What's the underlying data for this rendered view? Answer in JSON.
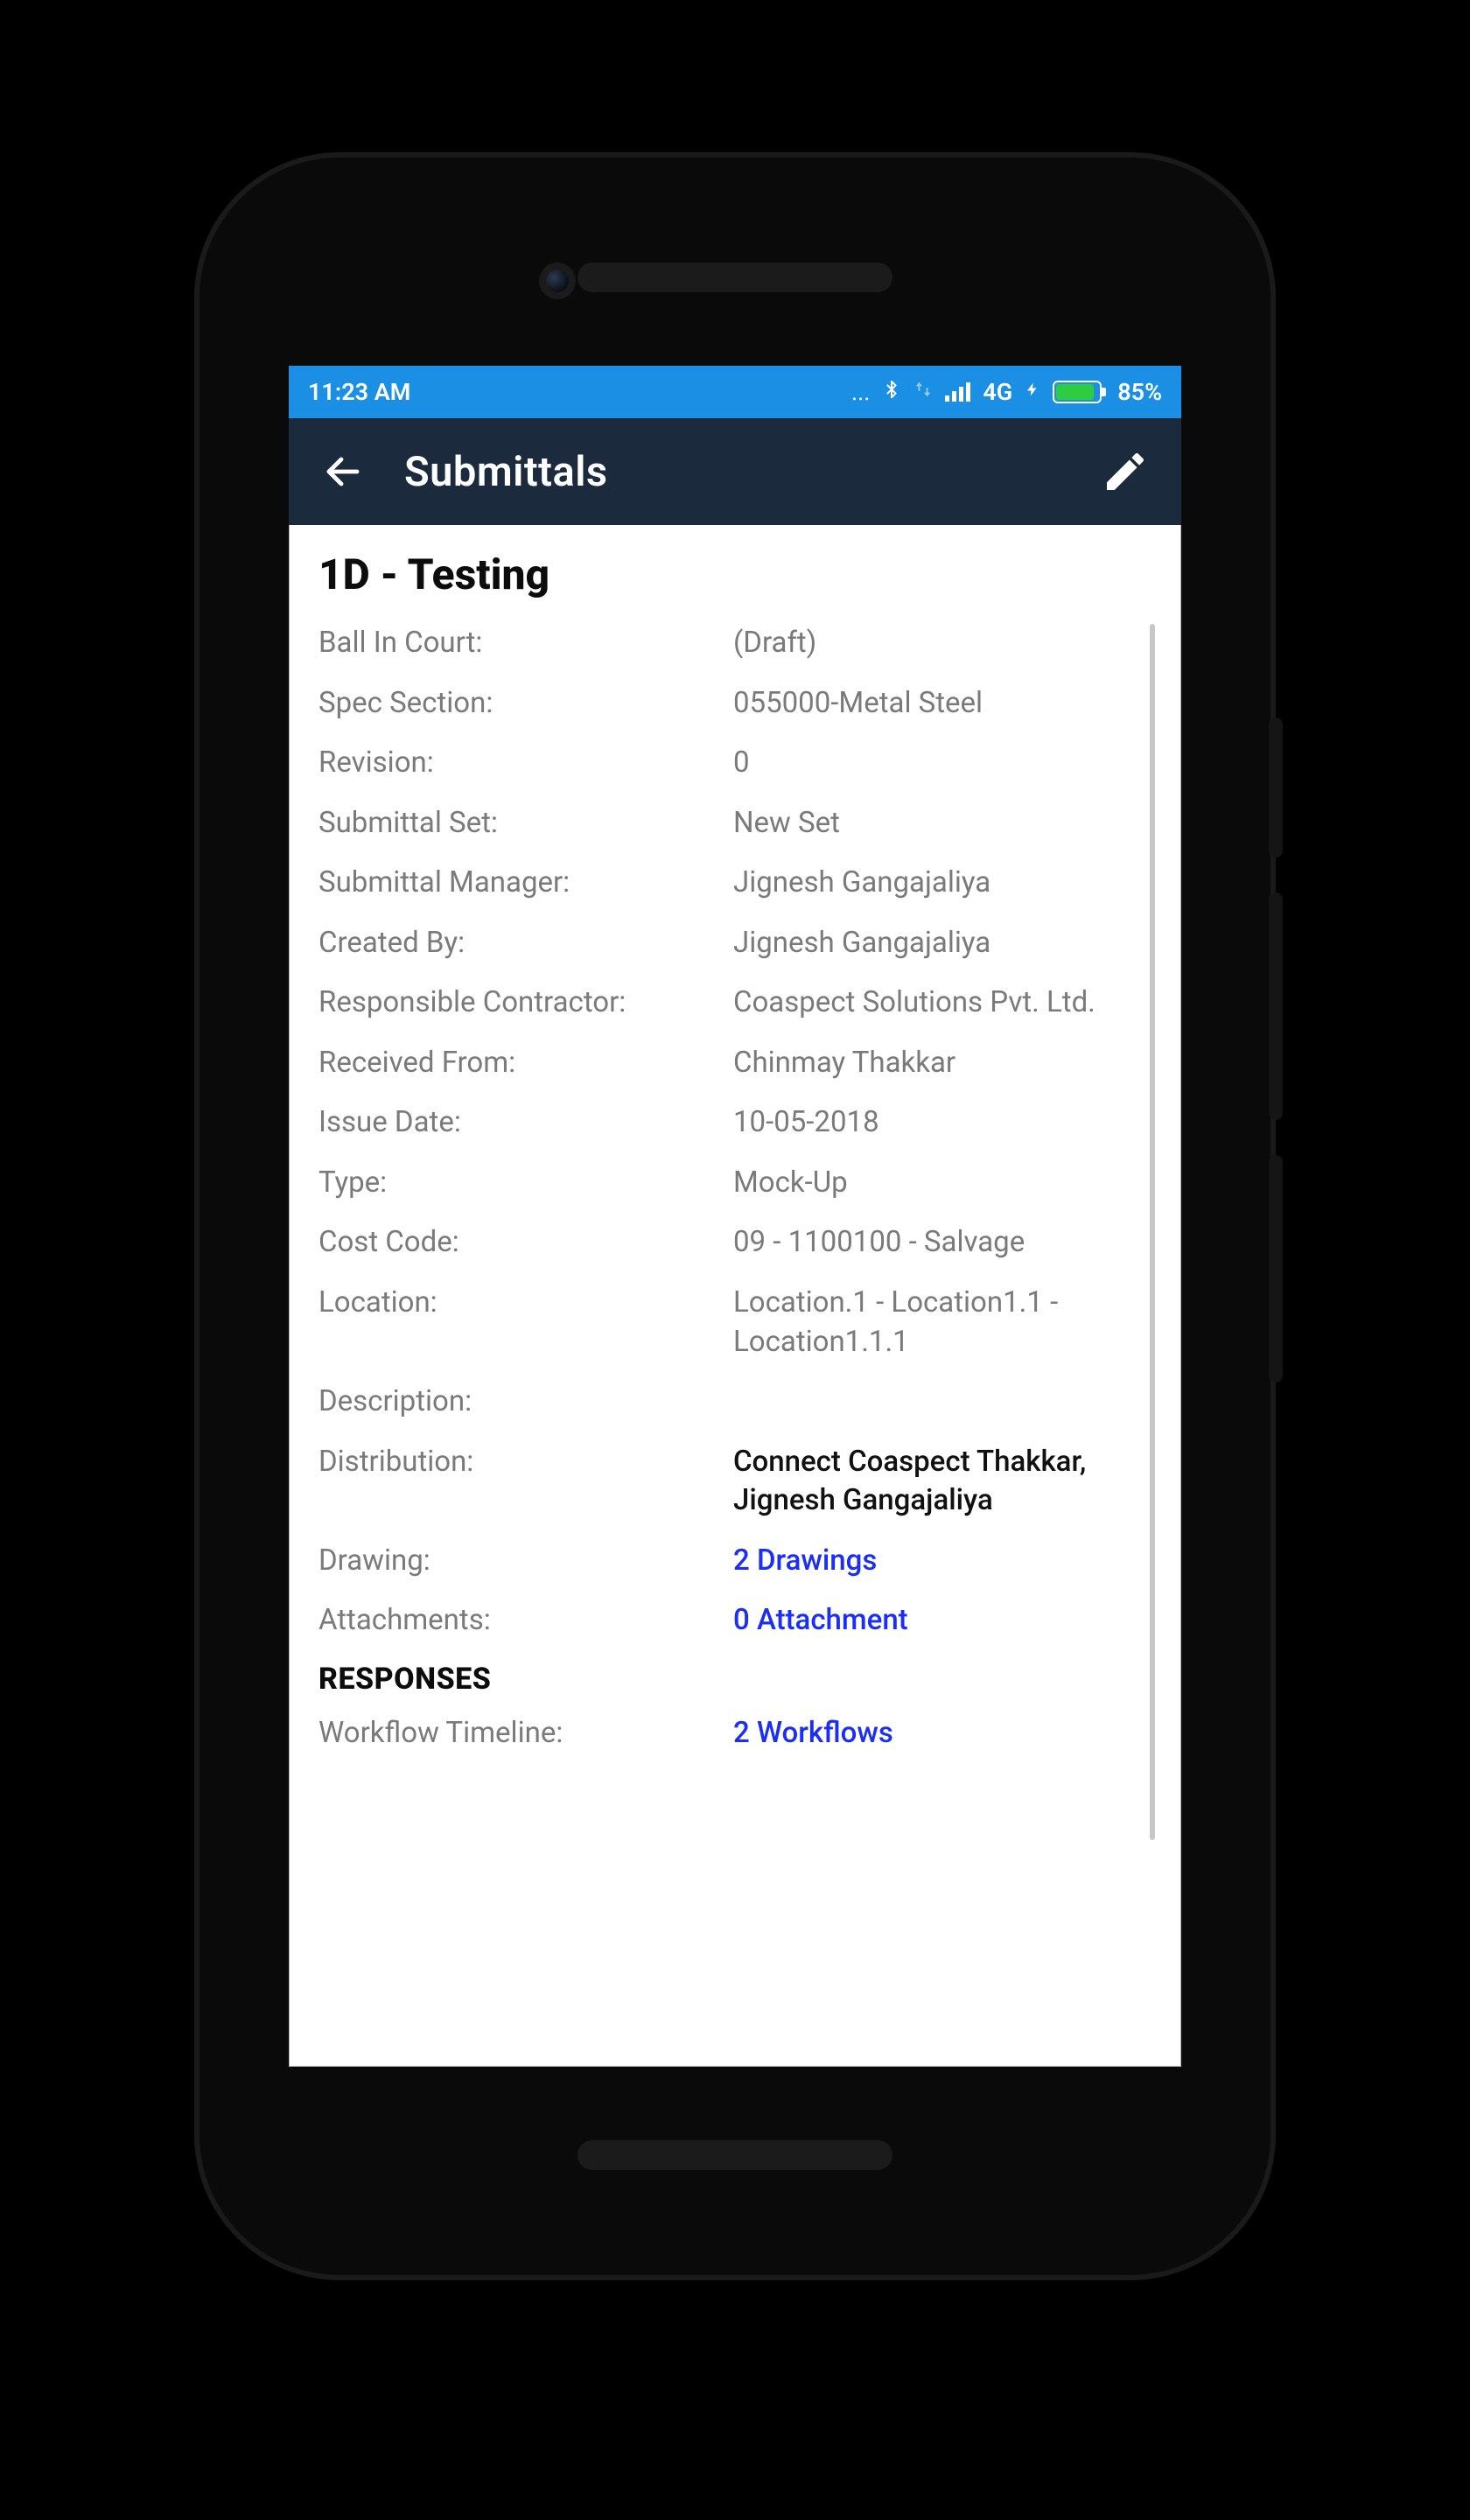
{
  "status": {
    "time": "11:23 AM",
    "dots": "...",
    "network": "4G",
    "charging": "⚡",
    "battery": "85%"
  },
  "appbar": {
    "title": "Submittals"
  },
  "page": {
    "title": "1D - Testing"
  },
  "details": {
    "ball_in_court_label": "Ball In Court:",
    "ball_in_court_value": "(Draft)",
    "spec_section_label": "Spec Section:",
    "spec_section_value": "055000-Metal Steel",
    "revision_label": "Revision:",
    "revision_value": "0",
    "submittal_set_label": "Submittal Set:",
    "submittal_set_value": "New Set",
    "submittal_manager_label": "Submittal Manager:",
    "submittal_manager_value": "Jignesh Gangajaliya",
    "created_by_label": "Created By:",
    "created_by_value": "Jignesh Gangajaliya",
    "resp_contractor_label": "Responsible Contractor:",
    "resp_contractor_value": "Coaspect Solutions Pvt. Ltd.",
    "received_from_label": "Received From:",
    "received_from_value": "Chinmay Thakkar",
    "issue_date_label": "Issue Date:",
    "issue_date_value": "10-05-2018",
    "type_label": "Type:",
    "type_value": "Mock-Up",
    "cost_code_label": "Cost Code:",
    "cost_code_value": "09 - 1100100 - Salvage",
    "location_label": "Location:",
    "location_value": "Location.1 - Location1.1 - Location1.1.1",
    "description_label": "Description:",
    "description_value": "",
    "distribution_label": "Distribution:",
    "distribution_value": "Connect Coaspect Thakkar, Jignesh Gangajaliya",
    "drawing_label": "Drawing:",
    "drawing_value": "2 Drawings",
    "attachments_label": "Attachments:",
    "attachments_value": "0 Attachment"
  },
  "responses": {
    "header": "RESPONSES",
    "workflow_label": "Workflow Timeline:",
    "workflow_value": "2 Workflows"
  }
}
